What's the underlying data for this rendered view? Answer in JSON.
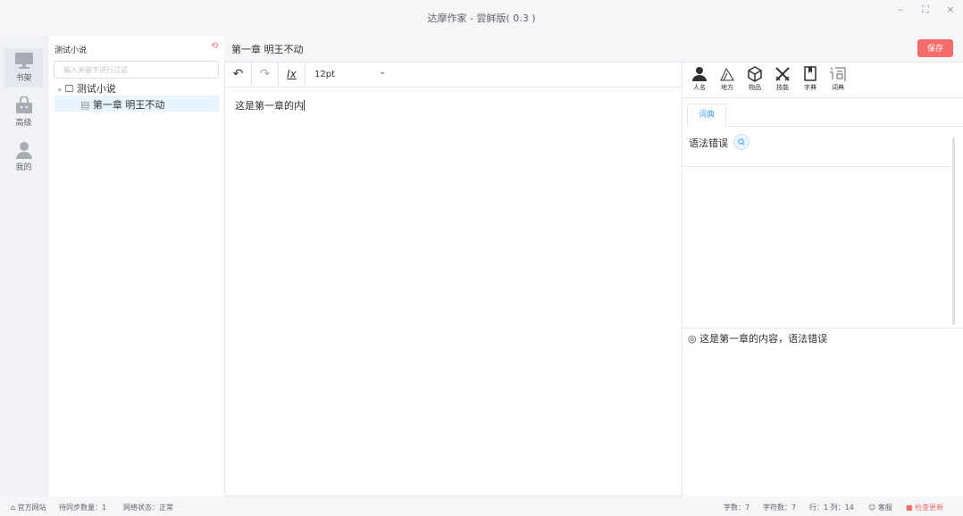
{
  "window": {
    "title": "达摩作家 - 尝鲜版( 0.3 )",
    "min_glyph": "–",
    "max_glyph": "⛶",
    "close_glyph": "×"
  },
  "nav": {
    "items": [
      {
        "label": "书架",
        "icon": "monitor-icon"
      },
      {
        "label": "高级",
        "icon": "bag-icon"
      },
      {
        "label": "我的",
        "icon": "user-icon"
      }
    ]
  },
  "tree": {
    "header": "测试小说",
    "refresh_glyph": "⟲",
    "filter_placeholder": "输入关键字进行过滤",
    "root_label": "测试小说",
    "root_glyph": "▾",
    "folder_glyph": "☐",
    "child_label": "第一章 明王不动",
    "doc_glyph": "▤"
  },
  "chapter": {
    "title": "第一章 明王不动"
  },
  "save_label": "保存",
  "toolbar": {
    "undo_glyph": "↶",
    "redo_glyph": "↷",
    "clear_glyph": "Ix",
    "font_size": "12pt",
    "chevron_glyph": "⌄"
  },
  "editor": {
    "content": "这是第一章的内"
  },
  "tools": [
    {
      "label": "人名",
      "icon": "person-icon"
    },
    {
      "label": "地方",
      "icon": "place-icon"
    },
    {
      "label": "物品",
      "icon": "cube-icon"
    },
    {
      "label": "技能",
      "icon": "swords-icon"
    },
    {
      "label": "字典",
      "icon": "book-icon"
    },
    {
      "label": "词典",
      "icon": "dictionary-icon"
    }
  ],
  "right": {
    "tab_label": "词典",
    "error_label": "语法错误",
    "preview_glyph": "◎",
    "preview_text": "这是第一章的内容，语法错误"
  },
  "status": {
    "website": "官方网站",
    "home_glyph": "⌂",
    "sync_count": "待同步数量：1",
    "network": "网络状态：正常",
    "word_count": "字数：7",
    "char_count": "字符数：7",
    "position": "行：1 列：14",
    "support": "客服",
    "support_glyph": "☺",
    "update": "检查更新",
    "update_glyph": "■"
  },
  "colors": {
    "accent": "#409eff",
    "danger": "#f56c6c",
    "selected_row": "#e8f4fd"
  }
}
